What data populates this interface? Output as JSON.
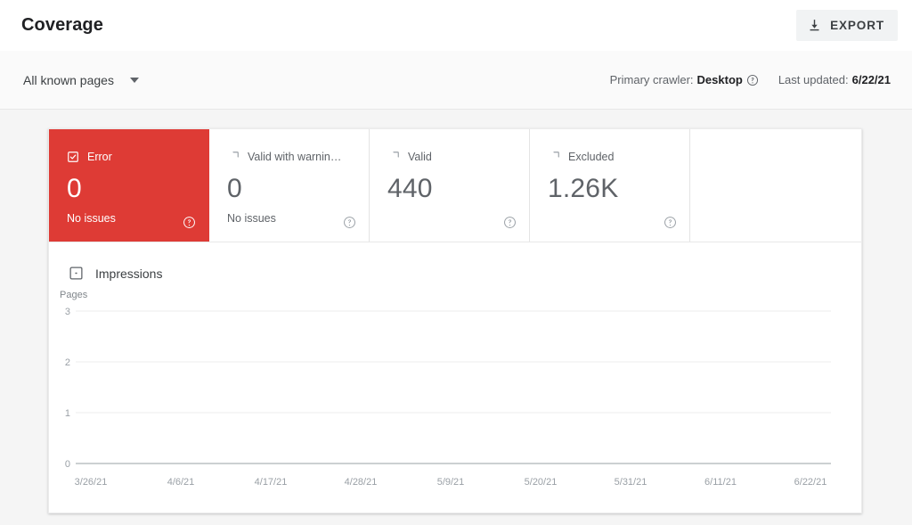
{
  "header": {
    "title": "Coverage",
    "export_label": "EXPORT",
    "export_icon": "download-icon"
  },
  "toolbar": {
    "filter_value": "All known pages",
    "filter_caret_icon": "chevron-down-icon",
    "primary_crawler_label": "Primary crawler:",
    "primary_crawler_value": "Desktop",
    "primary_crawler_help_icon": "help-circle-icon",
    "last_updated_label": "Last updated:",
    "last_updated_value": "6/22/21"
  },
  "cards": [
    {
      "title": "Error",
      "value": "0",
      "subtitle": "No issues",
      "checkbox": "checked",
      "selected": true,
      "color": "#DE3B35",
      "help_icon": "help-circle-icon"
    },
    {
      "title": "Valid with warnin…",
      "value": "0",
      "subtitle": "No issues",
      "checkbox": "unchecked",
      "selected": false,
      "color": "#ffffff",
      "help_icon": "help-circle-icon"
    },
    {
      "title": "Valid",
      "value": "440",
      "subtitle": "",
      "checkbox": "unchecked",
      "selected": false,
      "color": "#ffffff",
      "help_icon": "help-circle-icon"
    },
    {
      "title": "Excluded",
      "value": "1.26K",
      "subtitle": "",
      "checkbox": "unchecked",
      "selected": false,
      "color": "#ffffff",
      "help_icon": "help-circle-icon"
    }
  ],
  "legend": {
    "impressions_label": "Impressions",
    "impressions_checkbox": "indeterminate"
  },
  "chart_data": {
    "type": "line",
    "title": "",
    "xlabel": "",
    "ylabel": "Pages",
    "ylim": [
      0,
      3
    ],
    "yticks": [
      "0",
      "1",
      "2",
      "3"
    ],
    "grid": true,
    "legend_position": "top-left",
    "x": [
      "3/26/21",
      "4/6/21",
      "4/17/21",
      "4/28/21",
      "5/9/21",
      "5/20/21",
      "5/31/21",
      "6/11/21",
      "6/22/21"
    ],
    "series": [
      {
        "name": "Error",
        "color": "#DE3B35",
        "values": [
          0,
          0,
          0,
          0,
          0,
          0,
          0,
          0,
          0
        ]
      }
    ]
  }
}
